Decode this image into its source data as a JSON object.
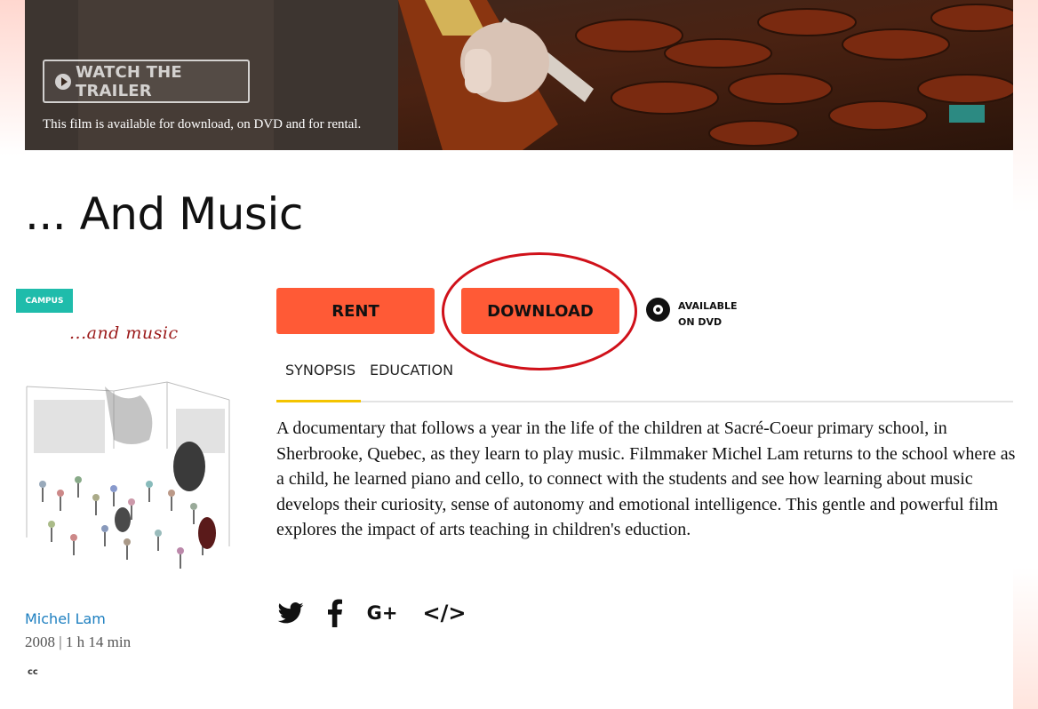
{
  "hero": {
    "trailer_label": "WATCH THE TRAILER",
    "availability": "This film is available for download, on DVD and for rental."
  },
  "film": {
    "title": "... And Music",
    "badge": "CAMPUS",
    "poster_title": "...and music",
    "director": "Michel Lam",
    "meta": "2008 | 1 h 14 min",
    "cc": "cc"
  },
  "actions": {
    "rent_label": "RENT",
    "download_label": "DOWNLOAD",
    "dvd_label_line1": "AVAILABLE",
    "dvd_label_line2": "ON DVD"
  },
  "tabs": [
    {
      "label": "SYNOPSIS",
      "active": true
    },
    {
      "label": "EDUCATION",
      "active": false
    }
  ],
  "synopsis": "A documentary that follows a year in the life of the children at Sacré-Coeur primary school, in Sherbrooke, Quebec, as they learn to play music. Filmmaker Michel Lam returns to the school where as a child, he learned piano and cello, to connect with the students and see how learning about music develops their curiosity, sense of autonomy and emotional intelligence. This gentle and powerful film explores the impact of arts teaching in children's eduction.",
  "social": {
    "google_label": "G+",
    "embed_label": "</>"
  },
  "colors": {
    "accent": "#ff5a36",
    "badge": "#1fbcab",
    "link": "#1d7fc0",
    "tab_underline": "#f4c400",
    "highlight": "#d0111a"
  }
}
